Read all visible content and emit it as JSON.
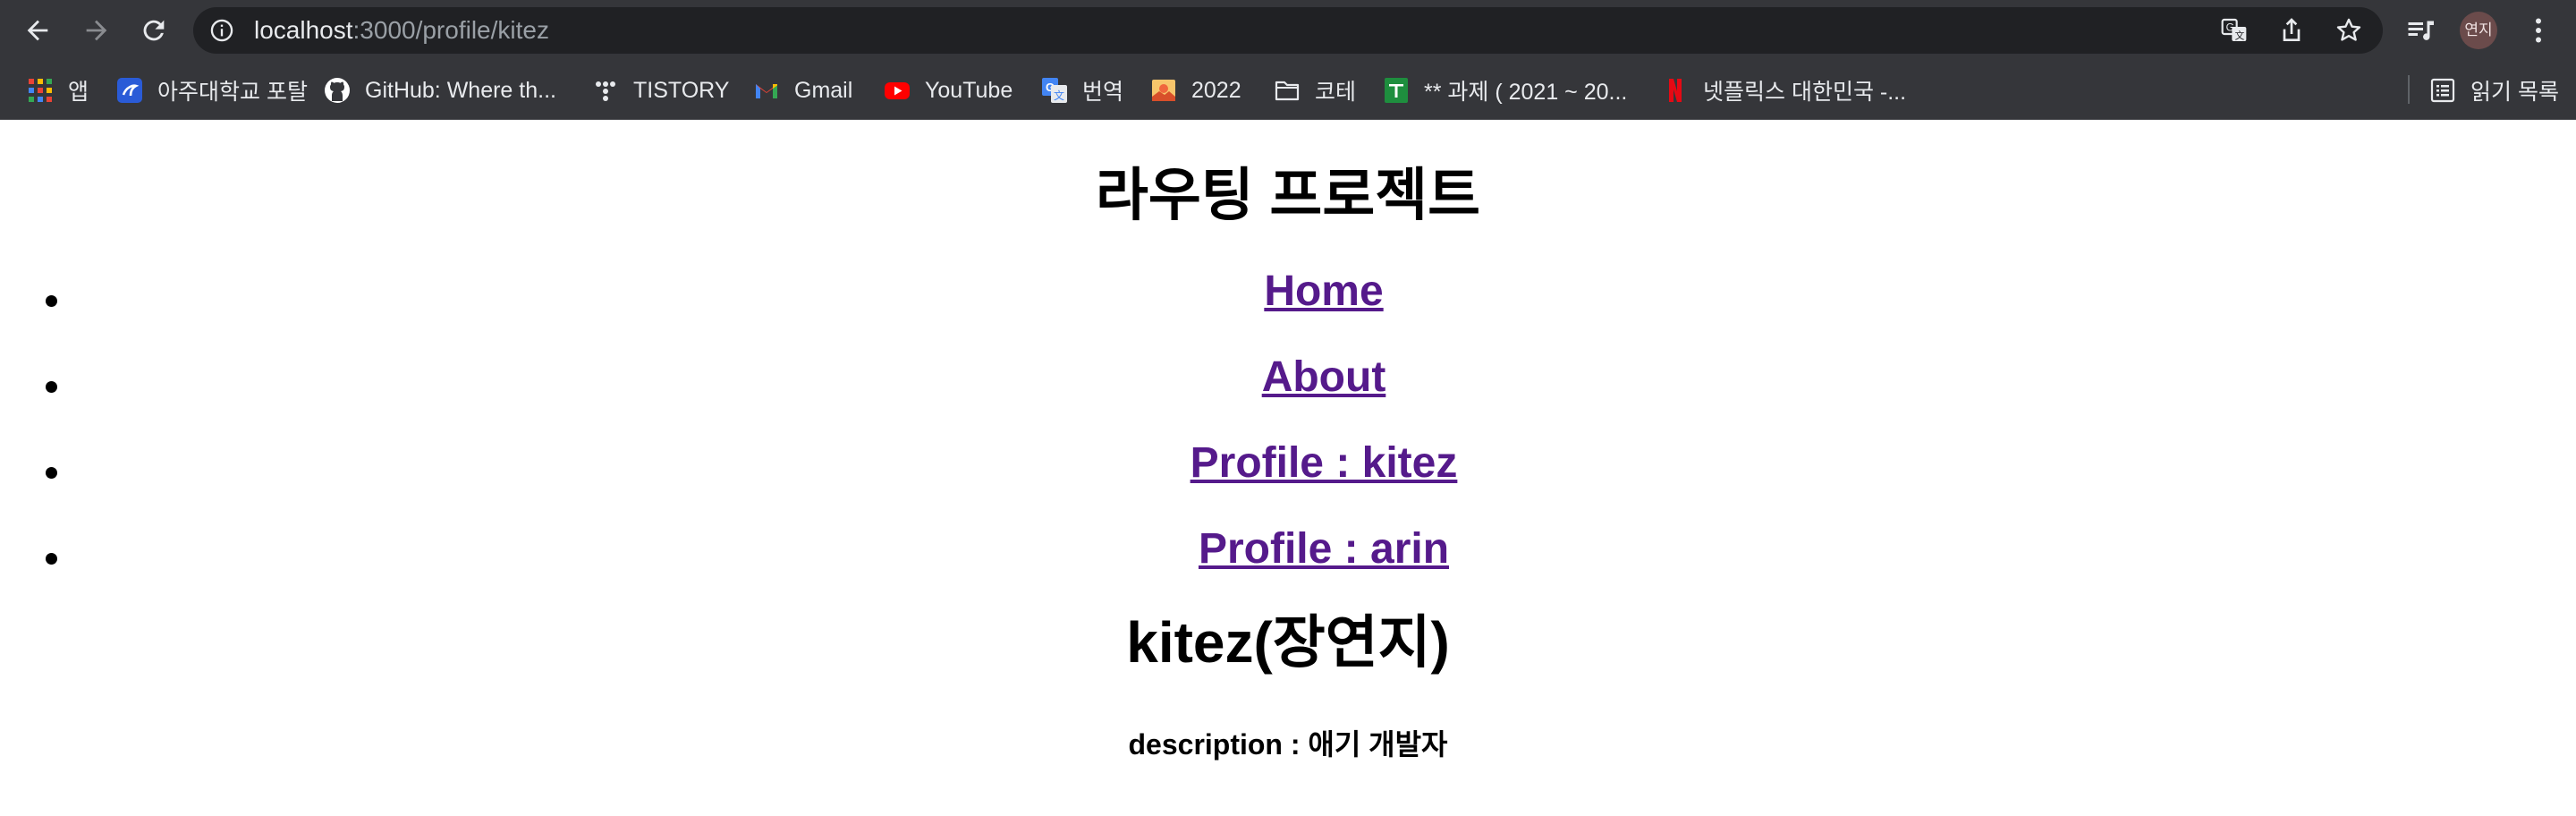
{
  "browser": {
    "url_host": "localhost",
    "url_path": ":3000/profile/kitez",
    "profile_initials": "연지",
    "reading_list_label": "읽기 목록"
  },
  "bookmarks": [
    {
      "label": "앱",
      "icon": "apps-grid-icon"
    },
    {
      "label": "아주대학교 포탈",
      "icon": "ajou-portal-icon"
    },
    {
      "label": "GitHub: Where th...",
      "icon": "github-icon"
    },
    {
      "label": "TISTORY",
      "icon": "tistory-icon"
    },
    {
      "label": "Gmail",
      "icon": "gmail-icon"
    },
    {
      "label": "YouTube",
      "icon": "youtube-icon"
    },
    {
      "label": "번역",
      "icon": "google-translate-icon"
    },
    {
      "label": "2022",
      "icon": "image-icon"
    },
    {
      "label": "코테",
      "icon": "folder-icon"
    },
    {
      "label": "** 과제 ( 2021 ~ 20...",
      "icon": "google-sheets-icon"
    },
    {
      "label": "넷플릭스 대한민국 -...",
      "icon": "netflix-icon"
    }
  ],
  "page": {
    "title": "라우팅 프로젝트",
    "nav_links": [
      {
        "label": "Home"
      },
      {
        "label": "About"
      },
      {
        "label": "Profile : kitez"
      },
      {
        "label": "Profile : arin"
      }
    ],
    "profile_name": "kitez(장연지)",
    "description": "description : 애기 개발자"
  },
  "colors": {
    "chrome_bg": "#35363a",
    "omnibox_bg": "#202124",
    "visited_link": "#551a8b"
  }
}
